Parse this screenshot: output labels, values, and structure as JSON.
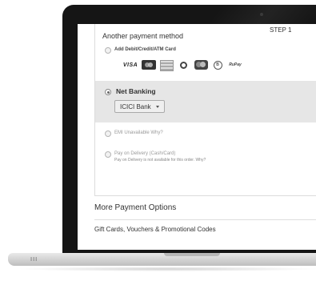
{
  "payment": {
    "step_label": "STEP 1",
    "section_title": "Another payment method",
    "options": {
      "card": {
        "label": "Add Debit/Credit/ATM Card"
      },
      "netbanking": {
        "label": "Net Banking",
        "selected_bank": "ICICI Bank"
      },
      "emi": {
        "label": "EMI Unavailable Why?"
      },
      "cod": {
        "label": "Pay on Delivery (Cash/Card)",
        "note": "Pay on Delivery is not available for this order. Why?"
      }
    },
    "card_logos": {
      "visa": "VISA",
      "rupay": "RuPay"
    }
  },
  "more_options": {
    "title": "More Payment Options",
    "gift_cards": "Gift Cards, Vouchers & Promotional Codes"
  },
  "laptop": {
    "ports_glyph": "III"
  },
  "icons": [
    "mastercard-icon",
    "generic-card-icon",
    "diners-club-icon",
    "maestro-icon",
    "amex-icon",
    "camera-icon"
  ],
  "colors": {
    "netbanking_bg": "#e6e6e6",
    "bezel": "#151515"
  }
}
